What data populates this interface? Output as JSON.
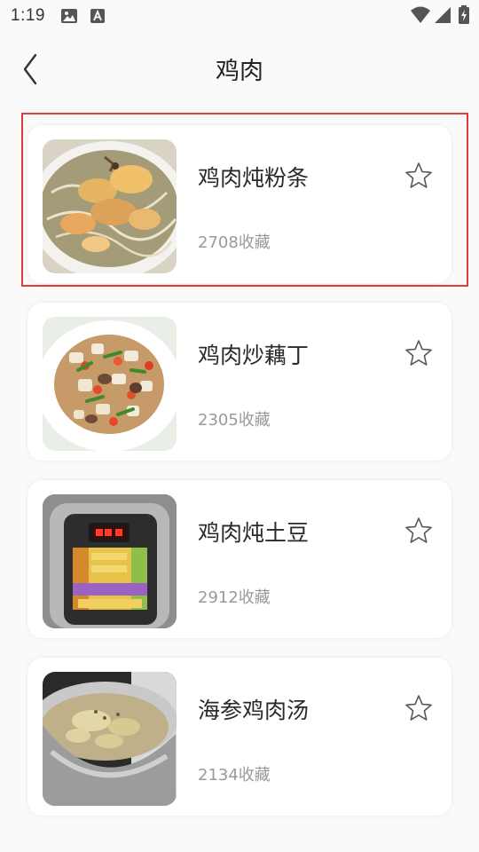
{
  "status_bar": {
    "time": "1:19",
    "icons": [
      "image-icon",
      "text-a-icon",
      "wifi-icon",
      "signal-icon",
      "battery-icon"
    ]
  },
  "header": {
    "back_icon": "chevron-left-icon",
    "title": "鸡肉"
  },
  "recipes": [
    {
      "name": "鸡肉炖粉条",
      "count": "2708收藏",
      "image": "chicken-vermicelli-stew",
      "favorited": false,
      "selected": true
    },
    {
      "name": "鸡肉炒藕丁",
      "count": "2305收藏",
      "image": "chicken-lotus-root-stirfry",
      "favorited": false,
      "selected": false
    },
    {
      "name": "鸡肉炖土豆",
      "count": "2912收藏",
      "image": "pressure-cooker",
      "favorited": false,
      "selected": false
    },
    {
      "name": "海参鸡肉汤",
      "count": "2134收藏",
      "image": "chicken-soup-pot",
      "favorited": false,
      "selected": false
    }
  ],
  "colors": {
    "highlight": "#e03a3a",
    "background": "#fafafa",
    "card": "#ffffff",
    "title_text": "#222222",
    "count_text": "#9a9a9a"
  }
}
